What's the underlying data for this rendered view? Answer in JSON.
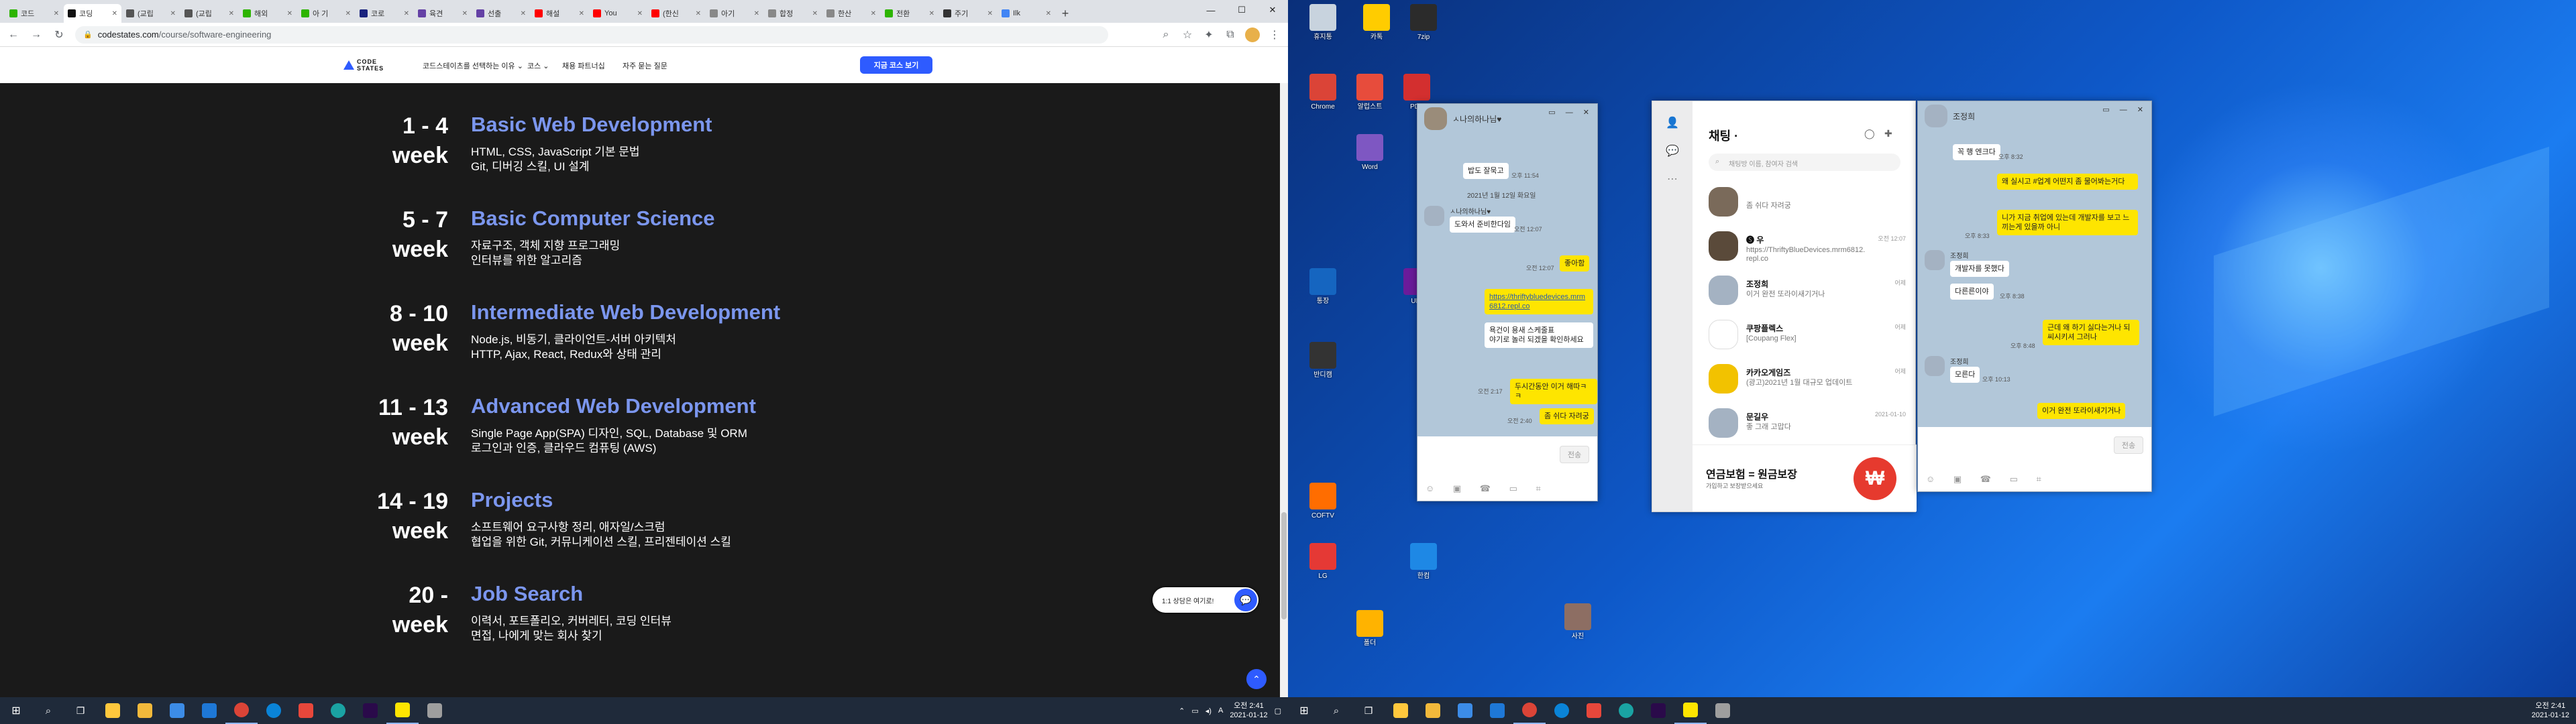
{
  "browser": {
    "tabs": [
      {
        "label": "코드",
        "color": "#2db400"
      },
      {
        "label": "코딩",
        "color": "#111111",
        "active": true
      },
      {
        "label": "(교립",
        "color": "#555555"
      },
      {
        "label": "(교립",
        "color": "#555555"
      },
      {
        "label": "해외",
        "color": "#2db400"
      },
      {
        "label": "아 기",
        "color": "#2db400"
      },
      {
        "label": "코로",
        "color": "#1a237e"
      },
      {
        "label": "육견",
        "color": "#6441a5"
      },
      {
        "label": "선출",
        "color": "#6441a5"
      },
      {
        "label": "해설",
        "color": "#ff0000"
      },
      {
        "label": "You",
        "color": "#ff0000"
      },
      {
        "label": "(한신",
        "color": "#ff0000"
      },
      {
        "label": "아기",
        "color": "#888888"
      },
      {
        "label": "합정",
        "color": "#888888"
      },
      {
        "label": "한산",
        "color": "#888888"
      },
      {
        "label": "전환",
        "color": "#2db400"
      },
      {
        "label": "주기",
        "color": "#333333"
      },
      {
        "label": "Ilk",
        "color": "#4285f4"
      }
    ],
    "url_host": "codestates.com",
    "url_path": "/course/software-engineering"
  },
  "site": {
    "logo_line1": "CODE",
    "logo_line2": "STATES",
    "nav": [
      "코드스테이츠를 선택하는 이유 ⌄",
      "코스 ⌄",
      "채용 파트너십",
      "자주 묻는 질문"
    ],
    "apply_label": "지금 코스 보기"
  },
  "curriculum": [
    {
      "week": "1 - 4\nweek",
      "title": "Basic Web Development",
      "desc": [
        "HTML, CSS, JavaScript 기본 문법",
        "Git, 디버깅 스킬, UI 설계"
      ]
    },
    {
      "week": "5 - 7\nweek",
      "title": "Basic Computer Science",
      "desc": [
        "자료구조, 객체 지향 프로그래밍",
        "인터뷰를 위한 알고리즘"
      ]
    },
    {
      "week": "8 - 10\nweek",
      "title": "Intermediate Web Development",
      "desc": [
        "Node.js, 비동기, 클라이언트-서버 아키텍처",
        "HTTP, Ajax, React, Redux와 상태 관리"
      ]
    },
    {
      "week": "11 - 13\nweek",
      "title": "Advanced Web Development",
      "desc": [
        "Single Page App(SPA) 디자인, SQL, Database 및 ORM",
        "로그인과 인증, 클라우드 컴퓨팅 (AWS)"
      ]
    },
    {
      "week": "14 - 19\nweek",
      "title": "Projects",
      "desc": [
        "소프트웨어 요구사항 정리, 애자일/스크럼",
        "협업을 위한 Git, 커뮤니케이션 스킬, 프리젠테이션 스킬"
      ]
    },
    {
      "week": "20 -\nweek",
      "title": "Job Search",
      "desc": [
        "이력서, 포트폴리오, 커버레터, 코딩 인터뷰",
        "면접, 나에게 맞는 회사 찾기"
      ]
    }
  ],
  "chat_pill": "1:1 상담은 여기로!",
  "clock": {
    "time": "오전 2:41",
    "date": "2021-01-12"
  },
  "kakao": {
    "list_title": "채팅 ·",
    "search_placeholder": "채팅방 이름, 참여자 검색",
    "rooms": [
      {
        "name": "",
        "msg": "좀 쉬다 자려궁",
        "time": "",
        "color": "#7a6a5a"
      },
      {
        "name": "🅢 우",
        "msg": "https://ThriftyBlueDevices.mrm6812.repl.co",
        "time": "오전 12:07",
        "color": "#5a4a3a"
      },
      {
        "name": "조정희",
        "msg": "이거 완전 또라이새기거나",
        "time": "어제",
        "color": "#a4b2c2"
      },
      {
        "name": "쿠팡플렉스",
        "msg": "[Coupang Flex]",
        "time": "어제",
        "color": "#ffffff"
      },
      {
        "name": "카카오게임즈",
        "msg": "(광고)2021년 1월 대규모 업데이트",
        "time": "어제",
        "color": "#f2c200"
      },
      {
        "name": "문길우",
        "msg": "좋 그래 고맙다",
        "time": "2021-01-10",
        "color": "#a4b2c2"
      }
    ],
    "ad_title": "연금보험 = 원금보장",
    "ad_sub": "가입하고 보장받으세요",
    "ad_coin": "₩",
    "left_chat": {
      "name": "ㅅ나의하나님♥",
      "day": "2021년 1월 12일 화요일",
      "msgs_in": [
        "밥도 잘묵고",
        "도와서 준비한다임",
        "욕건이 용새 스케줄표\n야기로 놀러 되겠을 확인하세요"
      ],
      "msgs_out": [
        "좋아함",
        "https://thriftybluedevices.mrm6812.repl.co",
        "두시간동안 이거 해따ㅋㅋ",
        "좀 쉬다 자려궁"
      ],
      "times": [
        "오후 11:54",
        "오전 12:07",
        "오전 12:07",
        "오전 2:17",
        "오전 2:40"
      ]
    },
    "right_chat": {
      "name": "조정희",
      "sender": "조정희",
      "msgs_in": [
        "꼭 행 엔크다",
        "개발자를 못했다",
        "다른른이야",
        "모른다"
      ],
      "msgs_out": [
        "왜 실시고 #업계 어떤지 좀 물어봐는거다",
        "니가 지금 취업에 있는데 개발자를 보고 느끼는게 있을까 아니",
        "근데 왜 하기 싫다는거나 되씨시키셔 그러나",
        "이거 완전 또라이새기거나"
      ],
      "times": [
        "오후 8:32",
        "오후 8:33",
        "오후 8:38",
        "오후 8:48",
        "오후 10:13"
      ]
    },
    "send_label": "전송"
  },
  "desktop_icons": [
    {
      "label": "휴지통",
      "color": "#c8d3de"
    },
    {
      "label": "카톡",
      "color": "#ffcc00"
    },
    {
      "label": "7zip",
      "color": "#2b2b2b"
    },
    {
      "label": "Chrome",
      "color": "#db4437"
    },
    {
      "label": "알럽스트",
      "color": "#e74c3c"
    },
    {
      "label": "PDF",
      "color": "#d32f2f"
    },
    {
      "label": "Word",
      "color": "#7e57c2"
    },
    {
      "label": "통장",
      "color": "#1565c0"
    },
    {
      "label": "반디캠",
      "color": "#333333"
    },
    {
      "label": "UNI",
      "color": "#6a1b9a"
    },
    {
      "label": "COFTV",
      "color": "#ff6d00"
    },
    {
      "label": "LG",
      "color": "#e53935"
    },
    {
      "label": "한컴",
      "color": "#1e88e5"
    },
    {
      "label": "폴더",
      "color": "#ffb300"
    },
    {
      "label": "사진",
      "color": "#8d6e63"
    }
  ]
}
